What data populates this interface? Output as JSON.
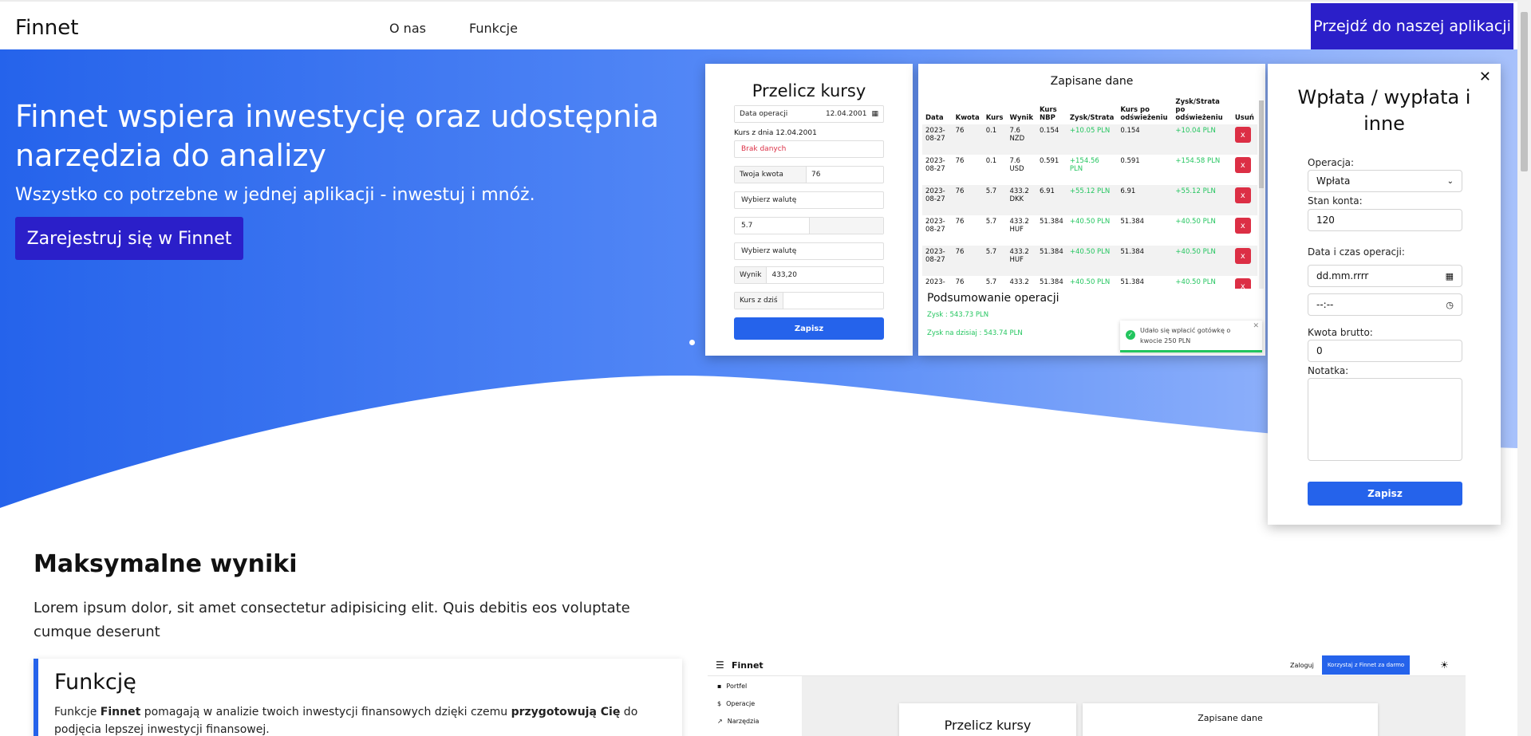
{
  "nav": {
    "brand": "Finnet",
    "links": [
      "O nas",
      "Funkcje"
    ],
    "cta": "Przejdź do naszej aplikacji"
  },
  "hero": {
    "title": "Finnet wspiera inwestycję oraz udostępnia narzędzia do analizy",
    "subtitle": "Wszystko co potrzebne w jednej aplikacji - inwestuj i mnóż.",
    "button": "Zarejestruj się w Finnet"
  },
  "calc_card": {
    "title": "Przelicz kursy",
    "date_label": "Data operacji",
    "date_value": "12.04.2001",
    "rate_date_text": "Kurs z dnia 12.04.2001",
    "no_data": "Brak danych",
    "amount_label": "Twoja kwota",
    "amount_value": "76",
    "currency_placeholder_1": "Wybierz walutę",
    "rate_value": "5.7",
    "currency_placeholder_2": "Wybierz walutę",
    "result_label": "Wynik",
    "result_value": "433,20",
    "today_rate_label": "Kurs z dziś",
    "save": "Zapisz"
  },
  "saved_card": {
    "title": "Zapisane dane",
    "headers": [
      "Data",
      "Kwota",
      "Kurs",
      "Wynik",
      "Kurs NBP",
      "Zysk/Strata",
      "Kurs po odświeżeniu",
      "Zysk/Strata po odświeżeniu",
      "Usuń"
    ],
    "rows": [
      [
        "2023-08-27",
        "76",
        "0.1",
        "7.6 NZD",
        "0.154",
        "+10.05 PLN",
        "0.154",
        "+10.04 PLN",
        "x"
      ],
      [
        "2023-08-27",
        "76",
        "0.1",
        "7.6 USD",
        "0.591",
        "+154.56 PLN",
        "0.591",
        "+154.58 PLN",
        "x"
      ],
      [
        "2023-08-27",
        "76",
        "5.7",
        "433.2 DKK",
        "6.91",
        "+55.12 PLN",
        "6.91",
        "+55.12 PLN",
        "x"
      ],
      [
        "2023-08-27",
        "76",
        "5.7",
        "433.2 HUF",
        "51.384",
        "+40.50 PLN",
        "51.384",
        "+40.50 PLN",
        "x"
      ],
      [
        "2023-08-27",
        "76",
        "5.7",
        "433.2 HUF",
        "51.384",
        "+40.50 PLN",
        "51.384",
        "+40.50 PLN",
        "x"
      ],
      [
        "2023-",
        "76",
        "5.7",
        "433.2",
        "51.384",
        "+40.50 PLN",
        "51.384",
        "+40.50 PLN",
        "x"
      ]
    ],
    "summary_title": "Podsumowanie operacji",
    "profit": "Zysk : 543.73 PLN",
    "profit_today": "Zysk na dzisiaj : 543.74 PLN",
    "toast": "Udało się wpłacić gotówkę o kwocie 250 PLN"
  },
  "deposit_card": {
    "title": "Wpłata / wypłata i inne",
    "close": "✕",
    "operation_label": "Operacja:",
    "operation_value": "Wpłata",
    "balance_label": "Stan konta:",
    "balance_value": "120",
    "datetime_label": "Data i czas operacji:",
    "date_placeholder": "dd.mm.rrrr",
    "time_placeholder": "--:--",
    "gross_label": "Kwota brutto:",
    "gross_value": "0",
    "note_label": "Notatka:",
    "save": "Zapisz"
  },
  "section": {
    "title": "Maksymalne wyniki",
    "text": "Lorem ipsum dolor, sit amet consectetur adipisicing elit. Quis debitis eos voluptate cumque deserunt",
    "feature_title": "Funkcję",
    "feature_text_1": "Funkcje ",
    "feature_bold_1": "Finnet",
    "feature_text_2": " pomagają w analizie twoich inwestycji finansowych dzięki czemu ",
    "feature_bold_2": "przygotowują Cię",
    "feature_text_3": " do podjęcia lepszej inwestycji finansowej."
  },
  "preview": {
    "brand": "Finnet",
    "login": "Zaloguj",
    "free_btn": "Korzystaj z Finnet za darmo",
    "side_items": [
      "Portfel",
      "Operacje",
      "Narzędzia"
    ],
    "card1": "Przelicz kursy",
    "card2": "Zapisane dane"
  },
  "colors": {
    "nav_cta": "#2b1fc9",
    "hero_blue": "#2f6bf3",
    "button_blue": "#2563eb",
    "danger": "#dc2f45",
    "profit_green": "#22c55e"
  }
}
